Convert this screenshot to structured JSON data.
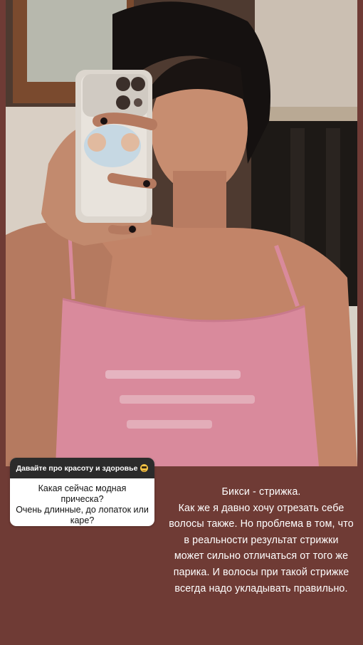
{
  "question": {
    "header": "Давайте про красоту и здоровье",
    "header_emoji": "sunglasses-face-icon",
    "lines": [
      "Какая сейчас модная прическа?",
      "Очень длинные, до лопаток или",
      "каре?"
    ]
  },
  "answer": {
    "lines": [
      "Бикси - стрижка.",
      "Как же я давно хочу отрезать себе",
      "волосы также. Но проблема в том, что",
      "в реальности результат стрижки",
      "может сильно отличаться от того же",
      "парика. И волосы при такой стрижке",
      "всегда надо укладывать правильно."
    ]
  },
  "colors": {
    "background": "#6f3b35",
    "sticker_header": "#2b2b2b",
    "top_color": "#d98a9c"
  }
}
